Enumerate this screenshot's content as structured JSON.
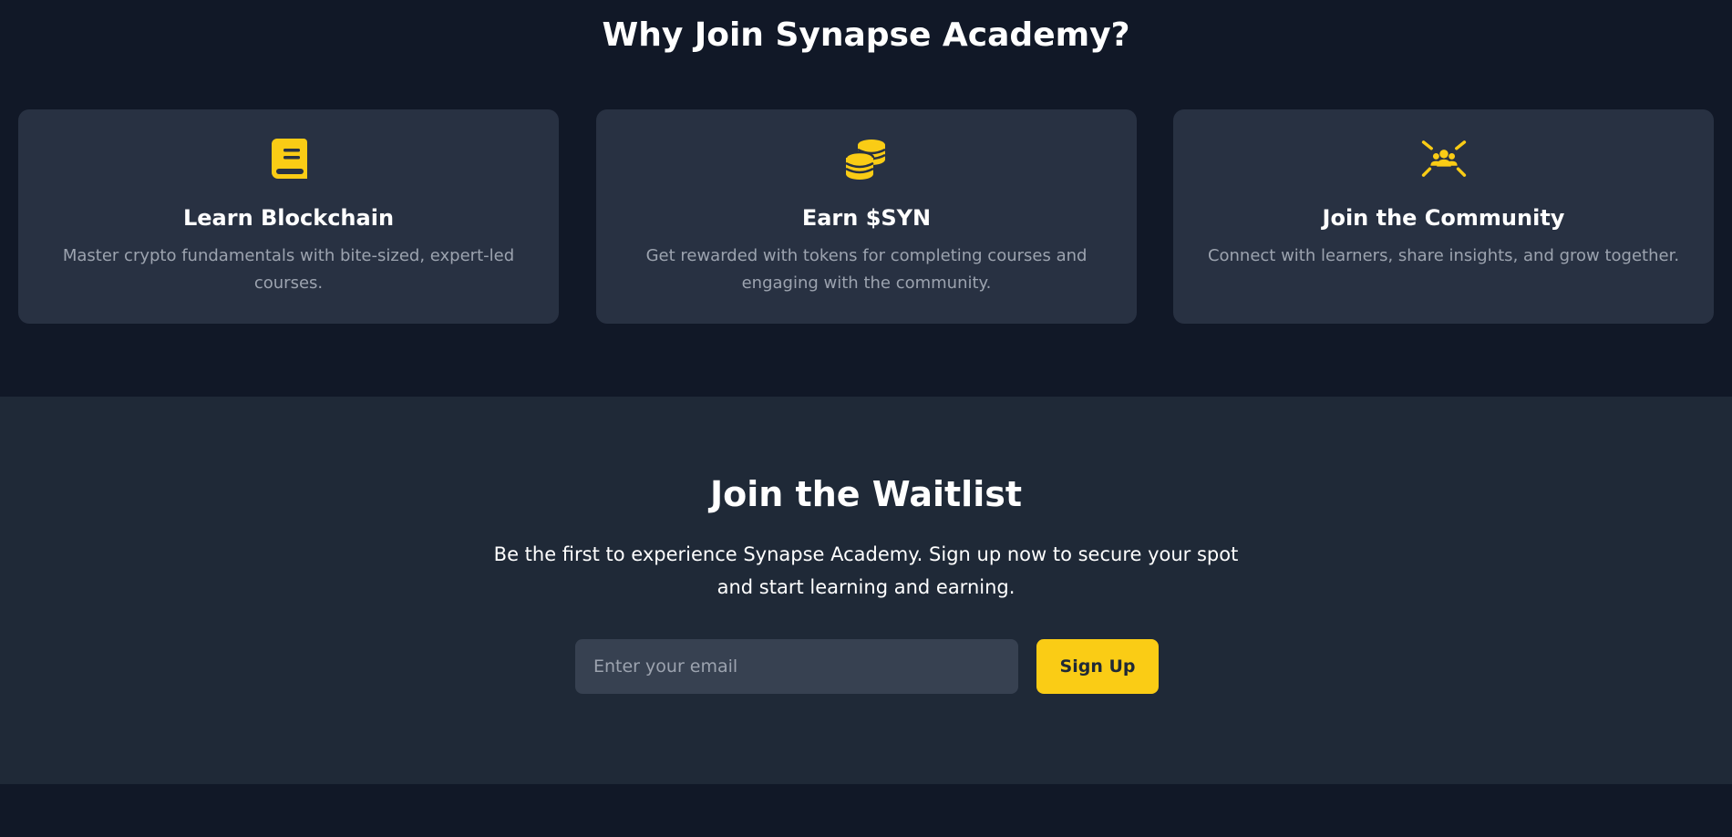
{
  "features": {
    "title": "Why Join Synapse Academy?",
    "cards": [
      {
        "icon": "book-icon",
        "title": "Learn Blockchain",
        "text": "Master crypto fundamentals with bite-sized, expert-led courses."
      },
      {
        "icon": "coins-icon",
        "title": "Earn $SYN",
        "text": "Get rewarded with tokens for completing courses and engaging with the community."
      },
      {
        "icon": "community-icon",
        "title": "Join the Community",
        "text": "Connect with learners, share insights, and grow together."
      }
    ]
  },
  "waitlist": {
    "title": "Join the Waitlist",
    "text": "Be the first to experience Synapse Academy. Sign up now to secure your spot and start learning and earning.",
    "email_placeholder": "Enter your email",
    "email_value": "",
    "button_label": "Sign Up"
  },
  "colors": {
    "page_background": "#111827",
    "card_background": "#283142",
    "section_background": "#1f2937",
    "input_background": "#374151",
    "accent": "#facc15",
    "muted_text": "#9ca3af"
  }
}
